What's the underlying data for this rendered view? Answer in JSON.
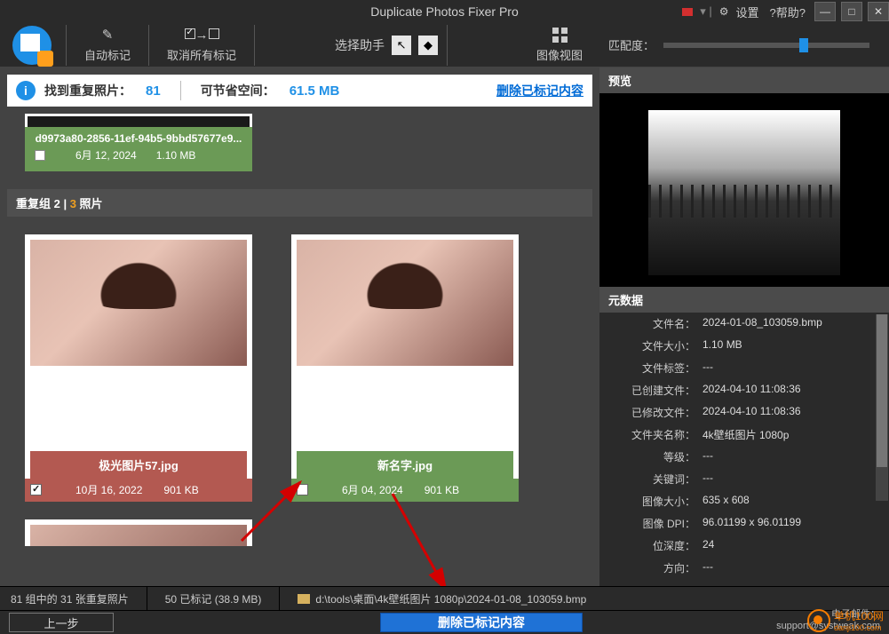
{
  "title": "Duplicate Photos Fixer Pro",
  "menu": {
    "settings": "设置",
    "help": "?帮助?"
  },
  "toolbar": {
    "auto_mark": "自动标记",
    "unmark_all": "取消所有标记",
    "select_assistant": "选择助手",
    "image_view": "图像视图"
  },
  "match": {
    "label": "匹配度："
  },
  "summary": {
    "found_label": "找到重复照片：",
    "found_count": "81",
    "save_label": "可节省空间：",
    "save_size": "61.5 MB",
    "delete_link": "删除已标记内容"
  },
  "old_item": {
    "filename": "d9973a80-2856-11ef-94b5-9bbd57677e9...",
    "date": "6月 12, 2024",
    "size": "1.10 MB"
  },
  "group_header": {
    "prefix": "重复组 2 | ",
    "count": "3",
    "suffix": " 照片"
  },
  "cards": [
    {
      "filename": "极光图片57.jpg",
      "date": "10月 16, 2022",
      "size": "901 KB",
      "checked": true,
      "tone": "red"
    },
    {
      "filename": "新名字.jpg",
      "date": "6月 04, 2024",
      "size": "901 KB",
      "checked": false,
      "tone": "green"
    }
  ],
  "preview": {
    "header": "预览"
  },
  "metadata": {
    "header": "元数据",
    "rows": [
      {
        "k": "文件名：",
        "v": "2024-01-08_103059.bmp"
      },
      {
        "k": "文件大小：",
        "v": "1.10 MB"
      },
      {
        "k": "文件标签：",
        "v": "---"
      },
      {
        "k": "已创建文件：",
        "v": "2024-04-10 11:08:36"
      },
      {
        "k": "已修改文件：",
        "v": "2024-04-10 11:08:36"
      },
      {
        "k": "文件夹名称：",
        "v": "4k壁纸图片 1080p"
      },
      {
        "k": "等级：",
        "v": "---"
      },
      {
        "k": "关键词：",
        "v": "---"
      },
      {
        "k": "图像大小：",
        "v": "635 x 608"
      },
      {
        "k": "图像 DPI：",
        "v": "96.01199 x 96.01199"
      },
      {
        "k": "位深度：",
        "v": "24"
      },
      {
        "k": "方向：",
        "v": "---"
      }
    ]
  },
  "statusbar": {
    "groups": "81 组中的 31 张重复照片",
    "marked": "50 已标记 (38.9 MB)",
    "path": "d:\\tools\\桌面\\4k壁纸图片 1080p\\2024-01-08_103059.bmp"
  },
  "footer": {
    "back": "上一步",
    "delete": "删除已标记内容",
    "email_label": "电子邮件：",
    "email": "support@systweak.com"
  },
  "watermark": {
    "text": "单机100网",
    "sub": "danji100.com"
  }
}
